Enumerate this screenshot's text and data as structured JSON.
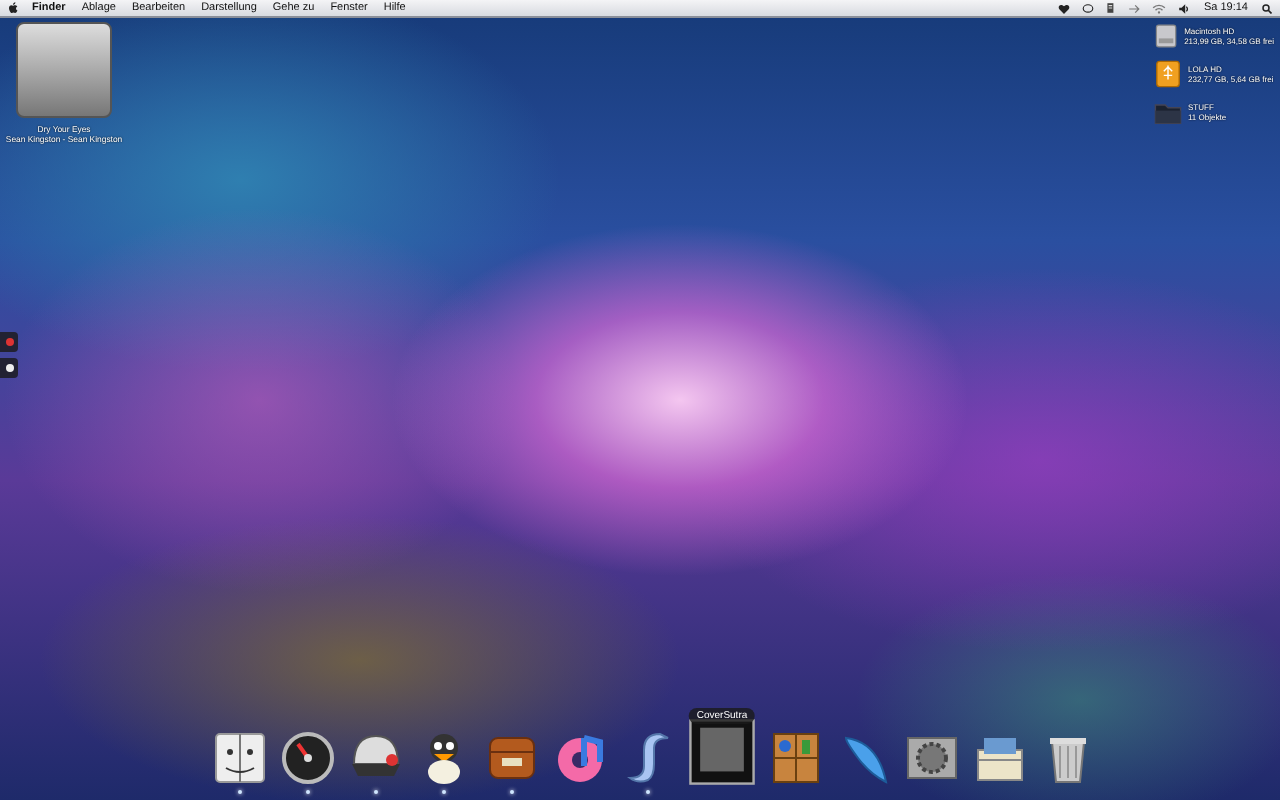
{
  "menu_bar": {
    "items": [
      {
        "label": "Finder",
        "selected": true
      },
      {
        "label": "Ablage",
        "selected": false
      },
      {
        "label": "Bearbeiten",
        "selected": false
      },
      {
        "label": "Darstellung",
        "selected": false
      },
      {
        "label": "Gehe zu",
        "selected": false
      },
      {
        "label": "Fenster",
        "selected": false
      },
      {
        "label": "Hilfe",
        "selected": false
      }
    ],
    "clock": "Sa 19:14"
  },
  "now_playing": {
    "title": "Dry Your Eyes",
    "artist": "Sean Kingston - Sean Kingston"
  },
  "desktop_icons": [
    {
      "kind": "disk",
      "name": "Macintosh HD",
      "info": "213,99 GB, 34,58 GB frei"
    },
    {
      "kind": "usb",
      "name": "LOLA HD",
      "info": "232,77 GB, 5,64 GB frei"
    },
    {
      "kind": "folder",
      "name": "STUFF",
      "info": "11 Objekte"
    }
  ],
  "dock": {
    "tooltip": "CoverSutra",
    "items": [
      {
        "kind": "finder",
        "running": true
      },
      {
        "kind": "dashboard",
        "running": true
      },
      {
        "kind": "cap",
        "running": true
      },
      {
        "kind": "duck",
        "running": true
      },
      {
        "kind": "mailbox",
        "running": true
      },
      {
        "kind": "donut",
        "running": false
      },
      {
        "kind": "scroll",
        "running": true
      },
      {
        "kind": "cover",
        "running": false
      },
      {
        "kind": "shelf",
        "running": false
      },
      {
        "kind": "feather",
        "running": false
      },
      {
        "kind": "prefs",
        "running": false
      },
      {
        "kind": "archive",
        "running": false
      },
      {
        "kind": "trash",
        "running": false
      }
    ]
  }
}
